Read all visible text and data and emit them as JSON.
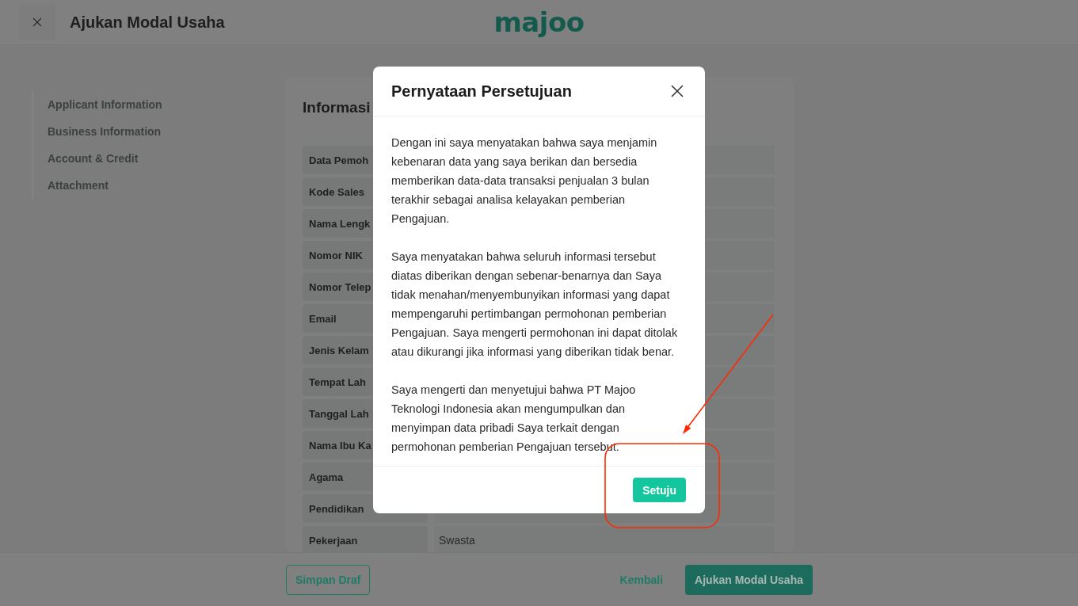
{
  "header": {
    "title": "Ajukan Modal Usaha",
    "logo": "majoo"
  },
  "sidebar": {
    "items": [
      {
        "label": "Applicant Information"
      },
      {
        "label": "Business Information"
      },
      {
        "label": "Account & Credit"
      },
      {
        "label": "Attachment"
      }
    ]
  },
  "form": {
    "title": "Informasi",
    "rows": [
      {
        "label": "Data Pemoh"
      },
      {
        "label": "Kode Sales"
      },
      {
        "label": "Nama Lengk"
      },
      {
        "label": "Nomor NIK"
      },
      {
        "label": "Nomor Telep"
      },
      {
        "label": "Email"
      },
      {
        "label": "Jenis Kelam"
      },
      {
        "label": "Tempat Lah"
      },
      {
        "label": "Tanggal Lah"
      },
      {
        "label": "Nama Ibu Ka"
      },
      {
        "label": "Agama"
      },
      {
        "label": "Pendidikan"
      },
      {
        "label": "Pekerjaan",
        "value": "Swasta"
      }
    ]
  },
  "footer": {
    "buttons": [
      {
        "kind": "outline",
        "label": "Simpan Draf"
      },
      {
        "kind": "text",
        "label": "Kembali"
      },
      {
        "kind": "primary",
        "label": "Ajukan Modal Usaha"
      }
    ]
  },
  "dialog": {
    "title": "Pernyataan Persetujuan",
    "paragraphs": [
      "Dengan ini saya menyatakan bahwa saya menjamin kebenaran data yang saya berikan dan bersedia memberikan data-data transaksi penjualan 3 bulan terakhir sebagai analisa kelayakan pemberian Pengajuan.",
      "Saya menyatakan bahwa seluruh informasi tersebut diatas diberikan dengan sebenar-benarnya dan Saya tidak menahan/menyembunyikan informasi yang dapat mempengaruhi pertimbangan permohonan pemberian Pengajuan. Saya mengerti permohonan ini dapat ditolak atau dikurangi jika informasi yang diberikan tidak benar.",
      "Saya mengerti dan menyetujui bahwa PT Majoo Teknologi Indonesia akan mengumpulkan dan menyimpan data pribadi Saya terkait dengan permohonan pemberian Pengajuan tersebut."
    ],
    "confirm": "Setuju"
  }
}
